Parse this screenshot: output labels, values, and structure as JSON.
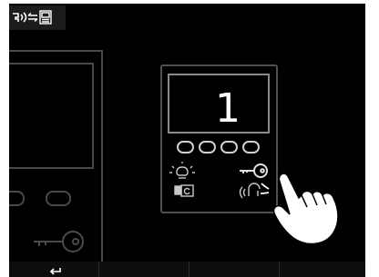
{
  "screen": {
    "title": "",
    "background": "#000000"
  },
  "status_bar": {
    "icons": [
      "door-bell-icon",
      "transfer-arrows-icon",
      "monitor-icon"
    ],
    "color": "#ffffff"
  },
  "illustration": {
    "monitor_number": "1",
    "monitor_buttons_count": 4,
    "icons": [
      "light-icon",
      "key-icon",
      "camera-icon",
      "intercom-icon",
      "tap-hand-icon"
    ],
    "outline_color": "#505050",
    "icon_color": "#c8c8c8"
  },
  "bottom_bar": {
    "items": [
      {
        "icon": "back-arrow-icon",
        "label": ""
      }
    ]
  }
}
